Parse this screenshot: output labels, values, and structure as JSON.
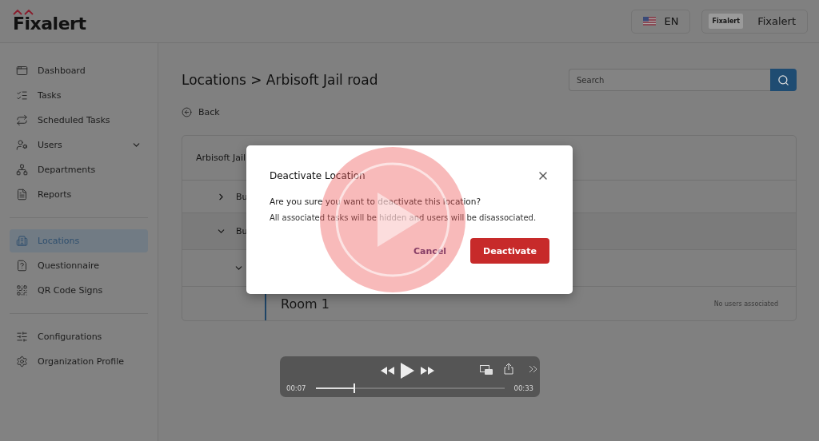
{
  "header": {
    "logo": "Fixalert",
    "language": "EN",
    "org_logo": "Fixalert",
    "org_name": "Fixalert"
  },
  "sidebar": {
    "groups": [
      [
        {
          "label": "Dashboard",
          "selected": false,
          "submenu": false
        },
        {
          "label": "Tasks",
          "selected": false,
          "submenu": false
        },
        {
          "label": "Scheduled Tasks",
          "selected": false,
          "submenu": false
        },
        {
          "label": "Users",
          "selected": false,
          "submenu": true
        },
        {
          "label": "Departments",
          "selected": false,
          "submenu": false
        },
        {
          "label": "Reports",
          "selected": false,
          "submenu": false
        }
      ],
      [
        {
          "label": "Locations",
          "selected": true,
          "submenu": false
        },
        {
          "label": "Questionnaire",
          "selected": false,
          "submenu": false
        },
        {
          "label": "QR Code Signs",
          "selected": false,
          "submenu": false
        }
      ],
      [
        {
          "label": "Configurations",
          "selected": false,
          "submenu": false
        },
        {
          "label": "Organization Profile",
          "selected": false,
          "submenu": false
        }
      ]
    ]
  },
  "page": {
    "title": "Locations > Arbisoft Jail road",
    "search": {
      "placeholder": "Search"
    },
    "back": "Back"
  },
  "tree": {
    "title": "Arbisoft Jail",
    "children": [
      {
        "name": "Bu",
        "expanded": false
      },
      {
        "name": "Bu",
        "expanded": true,
        "children": [
          {
            "expanded": true,
            "children": [
              {
                "name": "Room 1",
                "users": "No users associated"
              }
            ]
          }
        ]
      }
    ]
  },
  "dialog": {
    "title": "Deactivate Location",
    "message": "Are you sure you want to deactivate this location?",
    "note": "All associated tasks will be hidden and users will be disassociated.",
    "buttons": [
      {
        "label": "Cancel",
        "kind": "secondary"
      },
      {
        "label": "Deactivate",
        "kind": "danger"
      }
    ]
  },
  "player": {
    "elapsed": "00:07",
    "duration": "00:33",
    "level": 0.21
  }
}
